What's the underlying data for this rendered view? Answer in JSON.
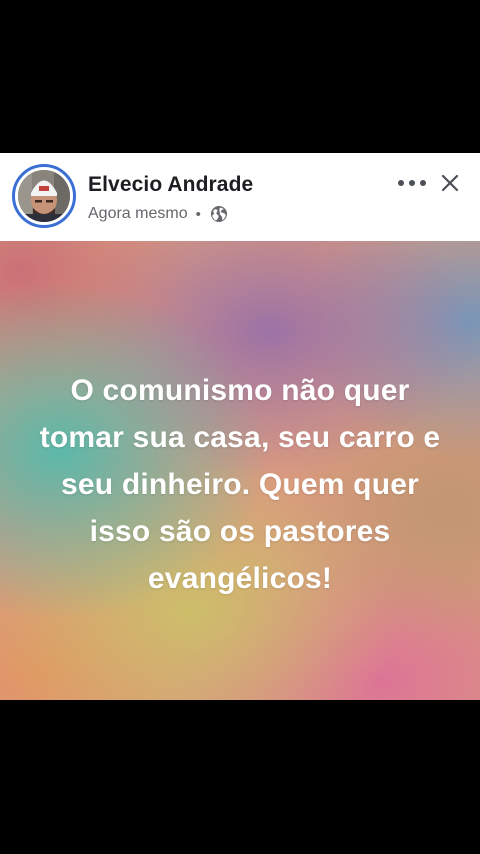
{
  "post": {
    "author": {
      "name": "Elvecio Andrade",
      "avatar_icon": "profile-photo"
    },
    "meta": {
      "timestamp": "Agora mesmo",
      "separator": "•",
      "audience_icon": "globe-icon"
    },
    "actions": {
      "more_icon": "more-horizontal-icon",
      "close_icon": "close-icon"
    },
    "text_lines": [
      "O comunismo não quer",
      "tomar sua casa, seu carro e",
      "seu dinheiro. Quem quer",
      "isso são os pastores",
      "evangélicos!"
    ]
  },
  "colors": {
    "letterbox": "#000000",
    "header_bg": "#ffffff",
    "name_text": "#1c1e21",
    "meta_text": "#65676b",
    "avatar_ring": "#3b6fd4",
    "post_text": "#ffffff"
  }
}
